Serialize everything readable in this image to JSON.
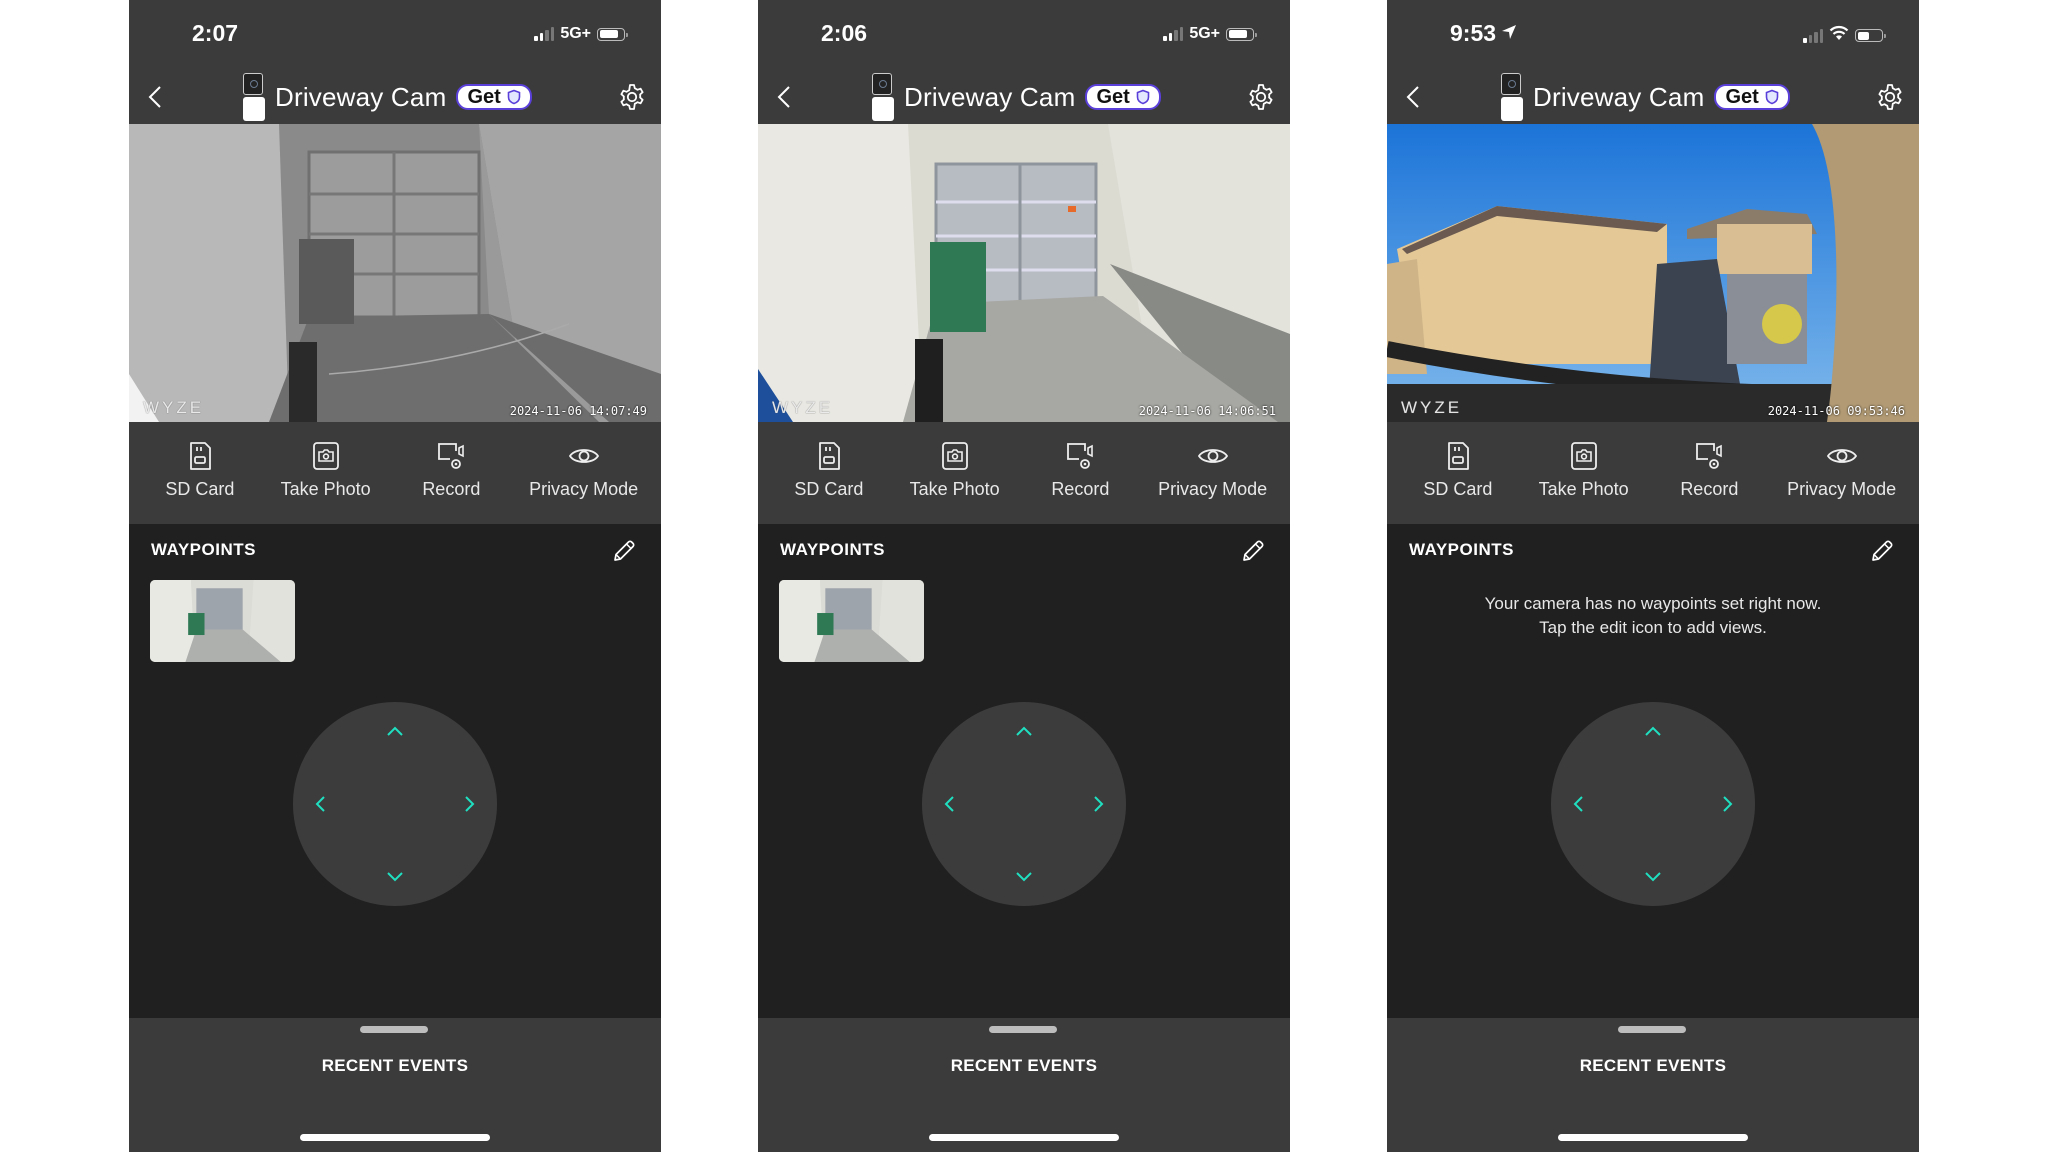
{
  "colors": {
    "accent": "#1fe0c0",
    "badge_border": "#5a3fd9",
    "panel": "#3b3b3b",
    "waypoints_bg": "#202020"
  },
  "phones": [
    {
      "status": {
        "time": "2:07",
        "location_arrow": false,
        "network": "5G+",
        "wifi": false,
        "signal_bars": 2,
        "battery_level": 0.8
      },
      "header": {
        "back_icon": "chevron-left-icon",
        "device_icon": "camera-device-icon",
        "title": "Driveway Cam",
        "badge_label": "Get",
        "badge_icon": "shield-icon",
        "settings_icon": "gear-icon"
      },
      "video": {
        "scene": "garage-night",
        "watermark": "WYZE",
        "timestamp": "2024-11-06 14:07:49"
      },
      "actions": [
        {
          "label": "SD Card",
          "icon": "sd-card-icon"
        },
        {
          "label": "Take Photo",
          "icon": "camera-icon"
        },
        {
          "label": "Record",
          "icon": "record-icon"
        },
        {
          "label": "Privacy Mode",
          "icon": "eye-icon"
        }
      ],
      "waypoints": {
        "title": "WAYPOINTS",
        "edit_icon": "pencil-icon",
        "has_thumbnail": true,
        "empty_line1": "",
        "empty_line2": ""
      },
      "joystick": {
        "up": "chevron-up-icon",
        "down": "chevron-down-icon",
        "left": "chevron-left-icon",
        "right": "chevron-right-icon"
      },
      "sheet": {
        "title": "RECENT EVENTS"
      }
    },
    {
      "status": {
        "time": "2:06",
        "location_arrow": false,
        "network": "5G+",
        "wifi": false,
        "signal_bars": 2,
        "battery_level": 0.8
      },
      "header": {
        "back_icon": "chevron-left-icon",
        "device_icon": "camera-device-icon",
        "title": "Driveway Cam",
        "badge_label": "Get",
        "badge_icon": "shield-icon",
        "settings_icon": "gear-icon"
      },
      "video": {
        "scene": "garage-day",
        "watermark": "WYZE",
        "timestamp": "2024-11-06 14:06:51"
      },
      "actions": [
        {
          "label": "SD Card",
          "icon": "sd-card-icon"
        },
        {
          "label": "Take Photo",
          "icon": "camera-icon"
        },
        {
          "label": "Record",
          "icon": "record-icon"
        },
        {
          "label": "Privacy Mode",
          "icon": "eye-icon"
        }
      ],
      "waypoints": {
        "title": "WAYPOINTS",
        "edit_icon": "pencil-icon",
        "has_thumbnail": true,
        "empty_line1": "",
        "empty_line2": ""
      },
      "joystick": {
        "up": "chevron-up-icon",
        "down": "chevron-down-icon",
        "left": "chevron-left-icon",
        "right": "chevron-right-icon"
      },
      "sheet": {
        "title": "RECENT EVENTS"
      }
    },
    {
      "status": {
        "time": "9:53",
        "location_arrow": true,
        "network": "",
        "wifi": true,
        "signal_bars": 1,
        "battery_level": 0.5
      },
      "header": {
        "back_icon": "chevron-left-icon",
        "device_icon": "camera-device-icon",
        "title": "Driveway Cam",
        "badge_label": "Get",
        "badge_icon": "shield-icon",
        "settings_icon": "gear-icon"
      },
      "video": {
        "scene": "balcony-outdoor",
        "watermark": "WYZE",
        "timestamp": "2024-11-06 09:53:46"
      },
      "actions": [
        {
          "label": "SD Card",
          "icon": "sd-card-icon"
        },
        {
          "label": "Take Photo",
          "icon": "camera-icon"
        },
        {
          "label": "Record",
          "icon": "record-icon"
        },
        {
          "label": "Privacy Mode",
          "icon": "eye-icon"
        }
      ],
      "waypoints": {
        "title": "WAYPOINTS",
        "edit_icon": "pencil-icon",
        "has_thumbnail": false,
        "empty_line1": "Your camera has no waypoints set right now.",
        "empty_line2": "Tap the edit icon to add views."
      },
      "joystick": {
        "up": "chevron-up-icon",
        "down": "chevron-down-icon",
        "left": "chevron-left-icon",
        "right": "chevron-right-icon"
      },
      "sheet": {
        "title": "RECENT EVENTS"
      }
    }
  ]
}
